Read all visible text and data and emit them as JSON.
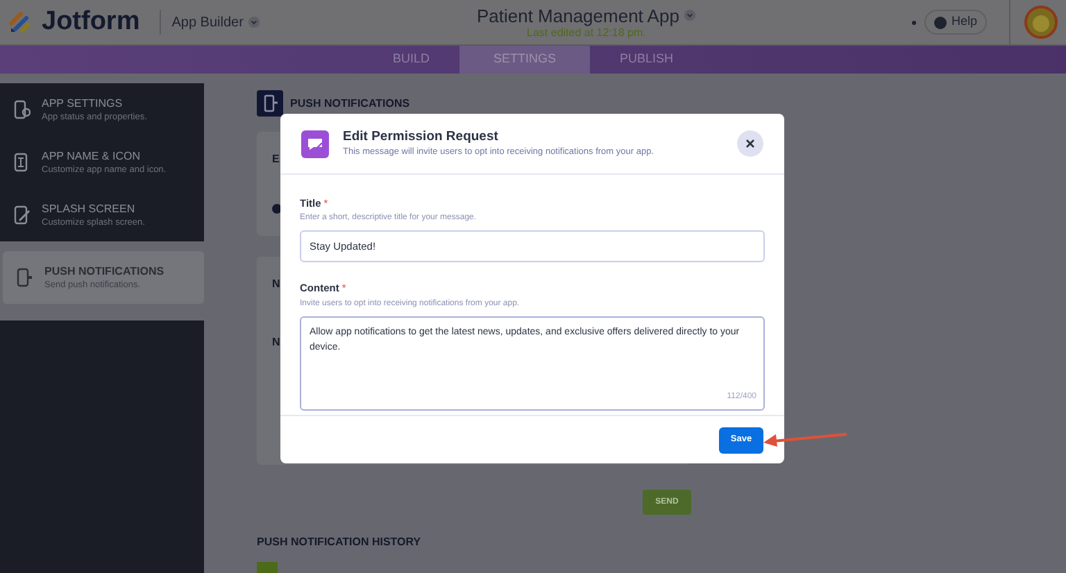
{
  "top_bar": {
    "logo": "Jotform",
    "app_builder": "App Builder",
    "app_title": "Patient Management App",
    "last_edited": "Last edited at 12:18 pm.",
    "help": "Help"
  },
  "nav_tabs": [
    {
      "label": "BUILD",
      "selected": false
    },
    {
      "label": "SETTINGS",
      "selected": true
    },
    {
      "label": "PUBLISH",
      "selected": false
    }
  ],
  "sidebar": {
    "items": [
      {
        "title": "APP SETTINGS",
        "subtitle": "App status and properties.",
        "selected": false
      },
      {
        "title": "APP NAME & ICON",
        "subtitle": "Customize app name and icon.",
        "selected": false
      },
      {
        "title": "SPLASH SCREEN",
        "subtitle": "Customize splash screen.",
        "selected": false
      },
      {
        "title": "PUSH NOTIFICATIONS",
        "subtitle": "Send push notifications.",
        "selected": true
      }
    ]
  },
  "section": {
    "title": "PUSH NOTIFICATIONS",
    "card_1_label": "E",
    "card_2_labels": [
      "N",
      "N"
    ],
    "send_button": "SEND",
    "history_title": "PUSH NOTIFICATION HISTORY"
  },
  "modal": {
    "title": "Edit Permission Request",
    "subtitle": "This message will invite users to opt into receiving notifications from your app.",
    "fields": [
      {
        "kind": "input",
        "label": "Title",
        "required": true,
        "required_mark": "*",
        "hint": "Enter a short, descriptive title for your message.",
        "value": "Stay Updated!"
      },
      {
        "kind": "textarea",
        "label": "Content",
        "required": true,
        "required_mark": "*",
        "hint": "Invite users to opt into receiving notifications from your app.",
        "value": "Allow app notifications to get the latest news, updates, and exclusive offers delivered directly to your device.",
        "counter": "112/400"
      }
    ],
    "save_button": "Save"
  }
}
